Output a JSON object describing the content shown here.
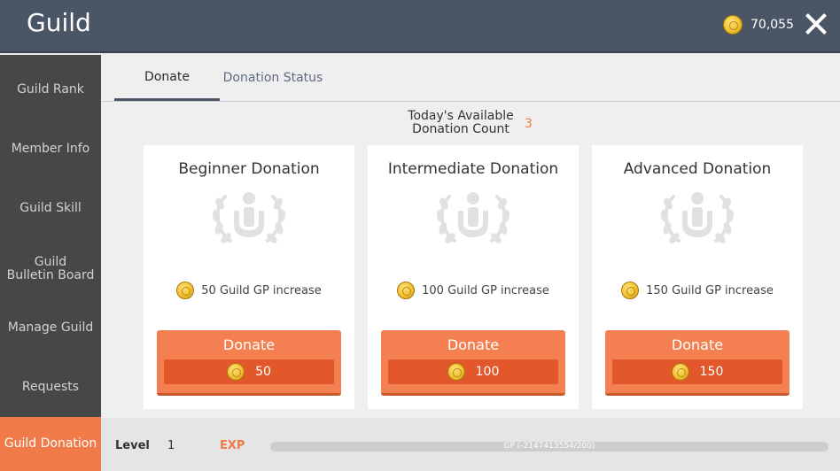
{
  "header": {
    "title": "Guild",
    "currency_value": "70,055",
    "close_icon": "close-icon",
    "currency_icon": "gold-coin-icon"
  },
  "sidebar": {
    "items": [
      {
        "label": "Guild Rank",
        "active": false
      },
      {
        "label": "Member Info",
        "active": false
      },
      {
        "label": "Guild Skill",
        "active": false
      },
      {
        "label": "Guild\nBulletin Board",
        "active": false
      },
      {
        "label": "Manage Guild",
        "active": false
      },
      {
        "label": "Requests",
        "active": false
      },
      {
        "label": "Guild Donation",
        "active": true
      }
    ]
  },
  "tabs": [
    {
      "label": "Donate",
      "active": true
    },
    {
      "label": "Donation Status",
      "active": false
    }
  ],
  "availability": {
    "label": "Today's Available\nDonation Count",
    "count": "3"
  },
  "cards": [
    {
      "title": "Beginner Donation",
      "gp_text": "50 Guild GP increase",
      "button_label": "Donate",
      "cost": "50"
    },
    {
      "title": "Intermediate Donation",
      "gp_text": "100 Guild GP increase",
      "button_label": "Donate",
      "cost": "100"
    },
    {
      "title": "Advanced Donation",
      "gp_text": "150 Guild GP increase",
      "button_label": "Donate",
      "cost": "150"
    }
  ],
  "footer": {
    "level_label": "Level",
    "level_value": "1",
    "exp_label": "EXP",
    "exp_text": "GP (-2147413554/200)",
    "exp_progress": 0
  },
  "colors": {
    "accent": "#f07a48",
    "header_bg": "#4a5566",
    "sidebar_bg": "#474747",
    "button": "#f47f50",
    "cost_bar": "#e2582b"
  }
}
